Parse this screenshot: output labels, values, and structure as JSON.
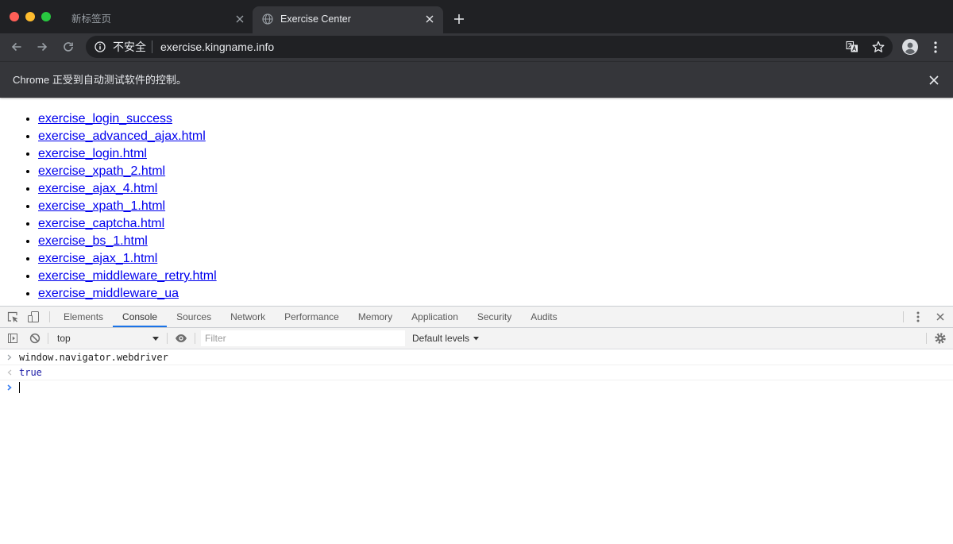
{
  "browser": {
    "tabs": [
      {
        "label": "新标签页",
        "active": false
      },
      {
        "label": "Exercise Center",
        "active": true
      }
    ],
    "omnibox": {
      "security_label": "不安全",
      "url": "exercise.kingname.info"
    },
    "infobar": {
      "message": "Chrome 正受到自动测试软件的控制。"
    }
  },
  "page": {
    "links": [
      "exercise_login_success",
      "exercise_advanced_ajax.html",
      "exercise_login.html",
      "exercise_xpath_2.html",
      "exercise_ajax_4.html",
      "exercise_xpath_1.html",
      "exercise_captcha.html",
      "exercise_bs_1.html",
      "exercise_ajax_1.html",
      "exercise_middleware_retry.html",
      "exercise_middleware_ua"
    ]
  },
  "devtools": {
    "tabs": [
      {
        "label": "Elements",
        "active": false
      },
      {
        "label": "Console",
        "active": true
      },
      {
        "label": "Sources",
        "active": false
      },
      {
        "label": "Network",
        "active": false
      },
      {
        "label": "Performance",
        "active": false
      },
      {
        "label": "Memory",
        "active": false
      },
      {
        "label": "Application",
        "active": false
      },
      {
        "label": "Security",
        "active": false
      },
      {
        "label": "Audits",
        "active": false
      }
    ],
    "console_toolbar": {
      "context": "top",
      "filter_placeholder": "Filter",
      "levels": "Default levels"
    },
    "console": {
      "command": "window.navigator.webdriver",
      "result": "true"
    }
  },
  "icons": {
    "window_controls": [
      "close-window-icon",
      "minimize-window-icon",
      "zoom-window-icon"
    ],
    "tab_strip": [
      "globe-icon",
      "close-icon",
      "plus-icon"
    ],
    "toolbar": [
      "back-arrow-icon",
      "forward-arrow-icon",
      "reload-icon",
      "info-icon",
      "translate-icon",
      "star-icon",
      "avatar-icon",
      "kebab-menu-icon"
    ],
    "devtools": [
      "inspect-element-icon",
      "device-toolbar-icon",
      "sidebar-toggle-icon",
      "clear-console-icon",
      "dropdown-arrow-icon",
      "eye-icon",
      "gear-icon",
      "close-icon"
    ],
    "console": [
      "input-prompt-icon",
      "result-prompt-icon",
      "active-prompt-icon"
    ]
  },
  "colors": {
    "frame": "#202124",
    "toolbar": "#35363a",
    "omnibox": "#202124",
    "chrome_text": "#e8eaed",
    "chrome_muted": "#9aa0a6",
    "link": "#0000ee",
    "devtools_bg": "#f3f3f3",
    "devtools_border": "#cacdd1",
    "devtools_accent": "#1a73e8",
    "console_result": "#1a1aa6",
    "console_prompt_active": "#367cf1",
    "traffic_close": "#ff5f57",
    "traffic_minimize": "#febc2e",
    "traffic_zoom": "#28c840"
  }
}
